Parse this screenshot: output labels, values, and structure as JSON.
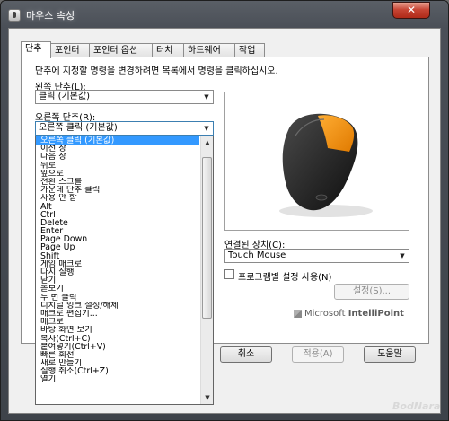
{
  "window": {
    "title": "마우스 속성",
    "close_label": "✕"
  },
  "tabs": [
    "단추",
    "포인터",
    "포인터 옵션",
    "터치",
    "하드웨어",
    "작업"
  ],
  "description": "단추에 지정할 명령을 변경하려면 목록에서 명령을 클릭하십시오.",
  "left_button": {
    "label": "왼쪽 단추(L):",
    "value": "클릭 (기본값)"
  },
  "right_button": {
    "label": "오른쪽 단추(R):",
    "value": "오른쪽 클릭 (기본값)"
  },
  "dropdown": {
    "selected_index": 0,
    "items": [
      "오른쪽 클릭 (기본값)",
      "이전 창",
      "다음 창",
      "뒤로",
      "앞으로",
      "전환 스크롤",
      "가운데 단추 클릭",
      "사용 안 함",
      "Alt",
      "Ctrl",
      "Delete",
      "Enter",
      "Page Down",
      "Page Up",
      "Shift",
      "게임 매크로",
      "다시 실행",
      "닫기",
      "돋보기",
      "두 번 클릭",
      "디지털 잉크 설정/해제",
      "매크로 편집기...",
      "매크로",
      "바탕 화면 보기",
      "복사(Ctrl+C)",
      "붙여넣기(Ctrl+V)",
      "빠른 회전",
      "새로 만들기",
      "실행 취소(Ctrl+Z)",
      "열기"
    ]
  },
  "device": {
    "label": "연결된 장치(C):",
    "value": "Touch Mouse"
  },
  "program_settings": {
    "label": "프로그램별 설정 사용(N)",
    "checked": false
  },
  "settings_button": "설정(S)...",
  "brand": {
    "company": "Microsoft",
    "product": "IntelliPoint"
  },
  "footer_buttons": {
    "cancel": "취소",
    "apply": "적용(A)",
    "help": "도움말"
  },
  "watermark": "BodNara",
  "colors": {
    "selection": "#3399ff",
    "mouse_accent": "#f08c00",
    "titlebar": "#4a4f57"
  },
  "icons": {
    "window": "mouse-icon",
    "close": "close-icon",
    "dropdown": "chevron-down-icon",
    "brand": "microsoft-logo-icon"
  }
}
